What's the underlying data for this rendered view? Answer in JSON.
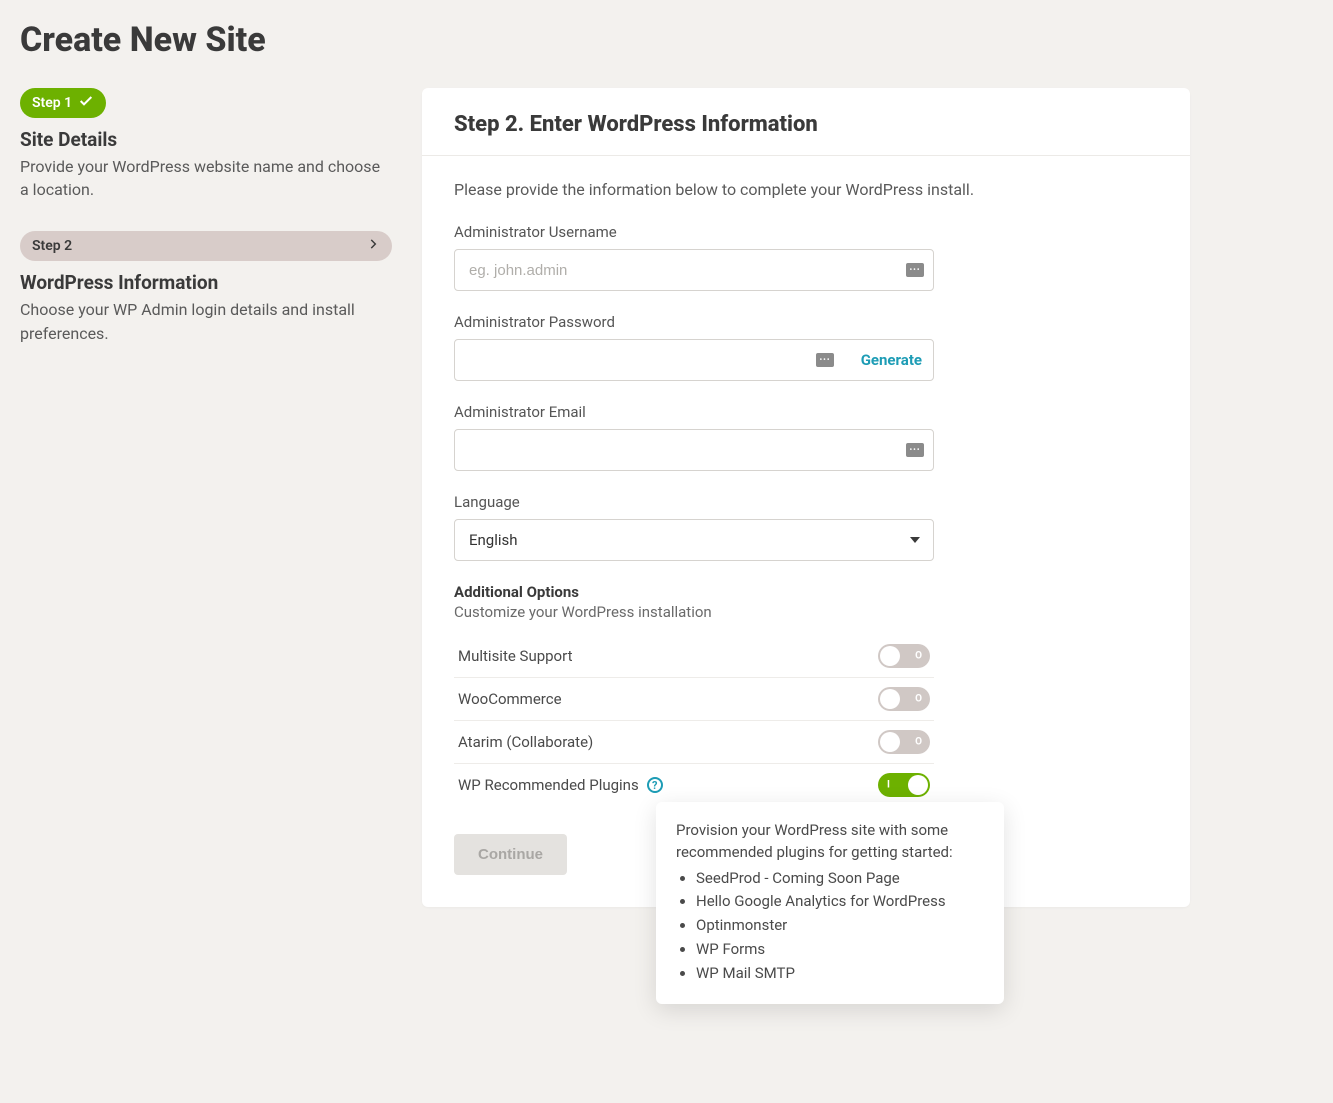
{
  "page": {
    "title": "Create New Site"
  },
  "sidebar": {
    "step1": {
      "badge": "Step 1",
      "title": "Site Details",
      "desc": "Provide your WordPress website name and choose a location."
    },
    "step2": {
      "badge": "Step 2",
      "title": "WordPress Information",
      "desc": "Choose your WP Admin login details and install preferences."
    }
  },
  "form": {
    "heading": "Step 2. Enter WordPress Information",
    "intro": "Please provide the information below to complete your WordPress install.",
    "username": {
      "label": "Administrator Username",
      "placeholder": "eg. john.admin",
      "value": ""
    },
    "password": {
      "label": "Administrator Password",
      "value": "",
      "generate": "Generate"
    },
    "email": {
      "label": "Administrator Email",
      "value": ""
    },
    "language": {
      "label": "Language",
      "value": "English"
    },
    "options": {
      "title": "Additional Options",
      "desc": "Customize your WordPress installation",
      "items": [
        {
          "label": "Multisite Support",
          "on": false
        },
        {
          "label": "WooCommerce",
          "on": false
        },
        {
          "label": "Atarim (Collaborate)",
          "on": false
        },
        {
          "label": "WP Recommended Plugins",
          "on": true,
          "help": true
        }
      ],
      "off_mark": "O",
      "on_mark": "I"
    },
    "continue": "Continue"
  },
  "tooltip": {
    "intro": "Provision your WordPress site with some recommended plugins for getting started:",
    "items": [
      "SeedProd - Coming Soon Page",
      "Hello Google Analytics for WordPress",
      "Optinmonster",
      "WP Forms",
      "WP Mail SMTP"
    ]
  }
}
